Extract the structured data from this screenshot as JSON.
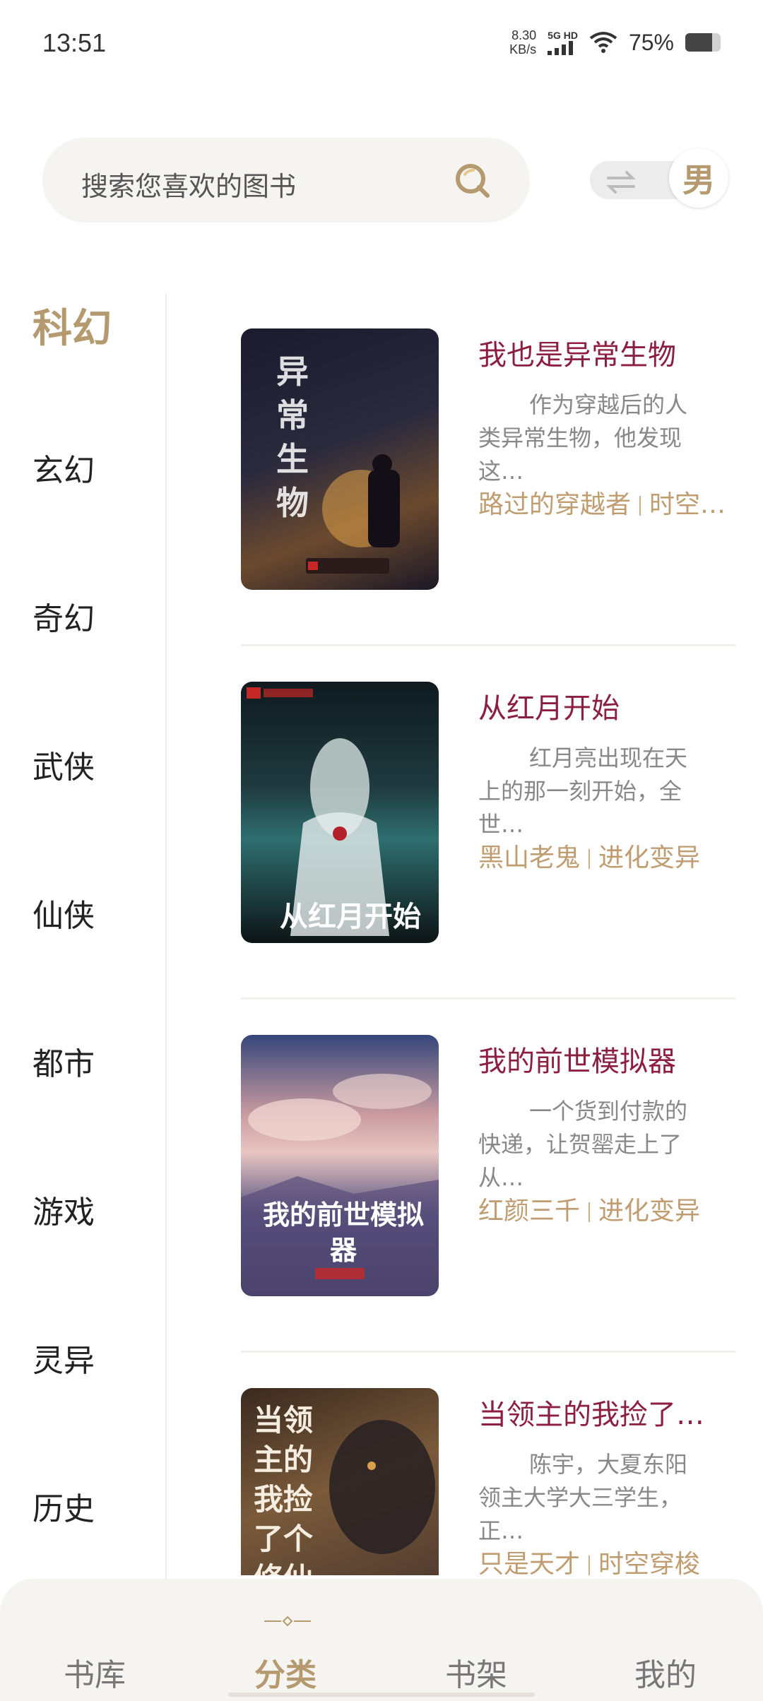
{
  "status_bar": {
    "time": "13:51",
    "net_speed_value": "8.30",
    "net_speed_unit": "KB/s",
    "signal_label": "5G HD",
    "battery_pct": "75%",
    "battery_level": 0.75
  },
  "search": {
    "placeholder": "搜索您喜欢的图书"
  },
  "gender_toggle": {
    "label": "男"
  },
  "sidebar": {
    "items": [
      {
        "label": "科幻",
        "active": true
      },
      {
        "label": "玄幻"
      },
      {
        "label": "奇幻"
      },
      {
        "label": "武侠"
      },
      {
        "label": "仙侠"
      },
      {
        "label": "都市"
      },
      {
        "label": "游戏"
      },
      {
        "label": "灵异"
      },
      {
        "label": "历史"
      }
    ]
  },
  "books": [
    {
      "title": "我也是异常生物",
      "desc": "作为穿越后的人类异常生物，他发现这…",
      "author": "路过的穿越者",
      "genre": "时空…",
      "cover_text": "异常生物"
    },
    {
      "title": "从红月开始",
      "desc": "红月亮出现在天上的那一刻开始，全世…",
      "author": "黑山老鬼",
      "genre": "进化变异",
      "cover_text": "从红月开始"
    },
    {
      "title": "我的前世模拟器",
      "desc": "一个货到付款的快递，让贺罂走上了从…",
      "author": "红颜三千",
      "genre": "进化变异",
      "cover_text": "我的前世模拟器"
    },
    {
      "title": "当领主的我捡了…",
      "desc": "陈宇，大夏东阳领主大学大三学生，正…",
      "author": "只是天才",
      "genre": "时空穿梭",
      "cover_text": "当领主的我捡了个修仙"
    }
  ],
  "bottom_nav": {
    "items": [
      {
        "label": "书库"
      },
      {
        "label": "分类",
        "active": true
      },
      {
        "label": "书架"
      },
      {
        "label": "我的"
      }
    ]
  },
  "colors": {
    "accent": "#b49a6e",
    "title": "#8c1f3f",
    "meta": "#c09d70",
    "desc": "#888888"
  }
}
